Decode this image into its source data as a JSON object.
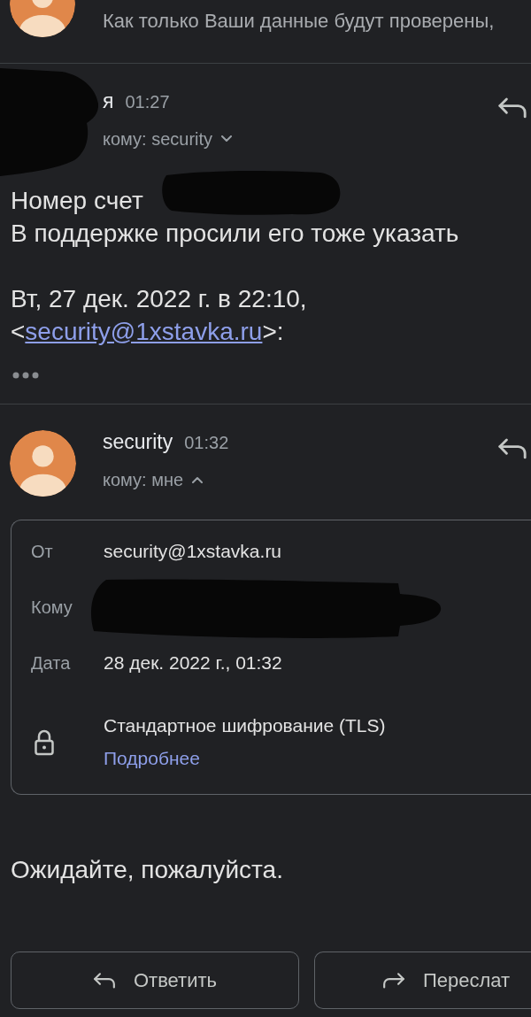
{
  "previous_message": {
    "snippet": "Как только Ваши данные будут проверены,"
  },
  "messages": [
    {
      "sender": "я",
      "time": "01:27",
      "recipients": "кому: security",
      "details_expanded": false,
      "avatar_redacted": true,
      "body": [
        {
          "text": "Номер счет",
          "redacted": true
        },
        {
          "text": "В поддержке просили его тоже указать",
          "redacted": false
        }
      ],
      "quote_attribution": {
        "date": "Вт, 27 дек. 2022 г. в 22:10,",
        "before": "<",
        "email": "security@1xstavka.ru",
        "after": ">:"
      },
      "trimmed_content": true
    },
    {
      "sender": "security",
      "time": "01:32",
      "recipients": "кому: мне",
      "details_expanded": true,
      "avatar_redacted": false,
      "details": [
        {
          "kind": "field",
          "label": "От",
          "value": "security@1xstavka.ru",
          "redacted": false
        },
        {
          "kind": "field",
          "label": "Кому",
          "redacted": true
        },
        {
          "kind": "field",
          "label": "Дата",
          "value": "28 дек. 2022 г., 01:32",
          "redacted": false
        },
        {
          "kind": "security",
          "value": "Стандартное шифрование (TLS)",
          "link": "Подробнее"
        }
      ],
      "body": [
        {
          "text": "Ожидайте, пожалуйста.",
          "redacted": false
        }
      ],
      "trimmed_content": false
    }
  ],
  "actions": [
    {
      "kind": "reply",
      "label": "Ответить"
    },
    {
      "kind": "forward",
      "label": "Переслат"
    }
  ]
}
